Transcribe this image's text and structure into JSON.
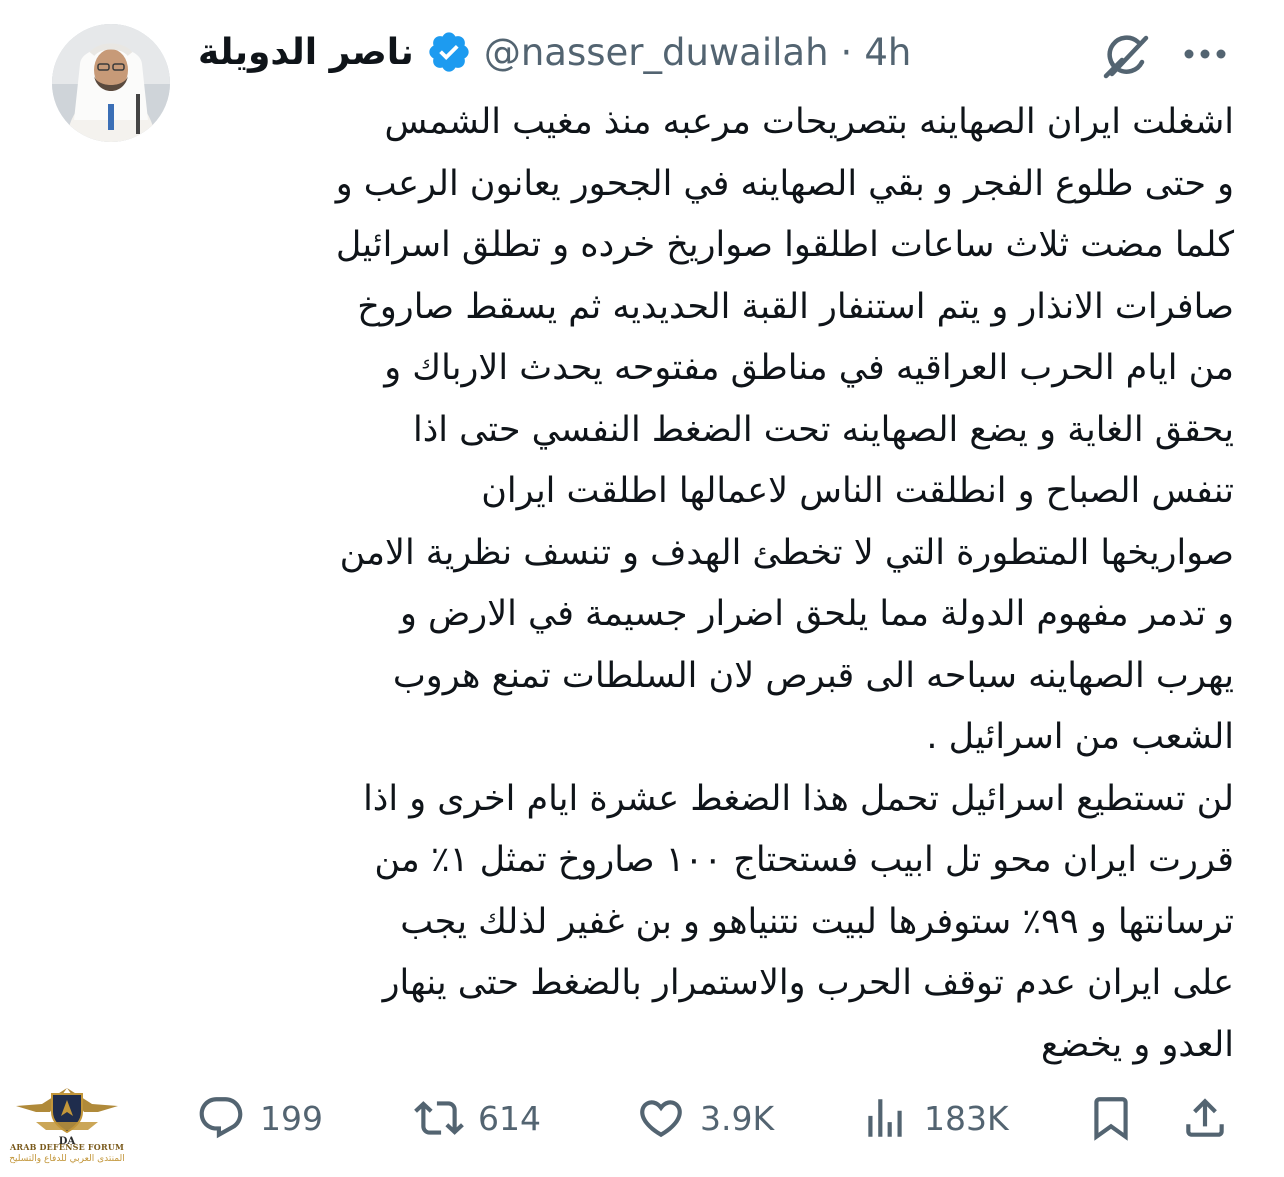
{
  "author": {
    "display_name": "ناصر الدويلة",
    "handle": "@nasser_duwailah",
    "separator": "·",
    "time": "4h",
    "verified_icon": "verified-badge-icon",
    "avatar": "profile-avatar"
  },
  "header_icons": {
    "grok": "grok-icon",
    "more": "more-options-icon"
  },
  "tweet": {
    "lines": [
      "اشغلت ايران الصهاينه بتصريحات مرعبه منذ مغيب الشمس",
      "و حتى طلوع الفجر و بقي الصهاينه في الجحور يعانون الرعب و",
      "كلما مضت ثلاث ساعات اطلقوا صواريخ خرده و تطلق اسرائيل",
      "صافرات الانذار و يتم استنفار القبة الحديديه ثم يسقط صاروخ",
      "من ايام الحرب العراقيه في مناطق مفتوحه يحدث الارباك و",
      "يحقق الغاية و يضع الصهاينه تحت الضغط النفسي حتى اذا",
      "تنفس الصباح و انطلقت الناس لاعمالها اطلقت ايران",
      "صواريخها المتطورة التي لا تخطئ الهدف و تنسف نظرية الامن",
      "و تدمر مفهوم الدولة مما يلحق اضرار جسيمة في الارض و",
      "يهرب الصهاينه سباحه الى قبرص لان السلطات تمنع هروب",
      "الشعب من اسرائيل .",
      "لن تستطيع اسرائيل تحمل هذا الضغط عشرة ايام اخرى و اذا",
      "قررت ايران محو تل ابيب فستحتاج ١٠٠ صاروخ تمثل ١٪ من",
      "ترسانتها و ٩٩٪ ستوفرها لبيت نتنياهو و بن غفير لذلك يجب",
      "على ايران عدم توقف الحرب والاستمرار بالضغط حتى ينهار",
      "العدو و يخضع"
    ]
  },
  "actions": {
    "replies": {
      "count": "199",
      "icon": "reply-icon"
    },
    "reposts": {
      "count": "614",
      "icon": "repost-icon"
    },
    "likes": {
      "count": "3.9K",
      "icon": "like-heart-icon"
    },
    "views": {
      "count": "183K",
      "icon": "views-analytics-icon"
    },
    "bookmark": {
      "icon": "bookmark-icon"
    },
    "share": {
      "icon": "share-icon"
    }
  },
  "watermark": {
    "title": "ARAB DEFENSE FORUM",
    "subtitle": "المنتدى العربي للدفاع والتسليح",
    "monogram": "DA"
  },
  "colors": {
    "text": "#0f1419",
    "secondary": "#536471",
    "verified": "#1d9bf0",
    "watermark_gold": "#c2963a"
  }
}
